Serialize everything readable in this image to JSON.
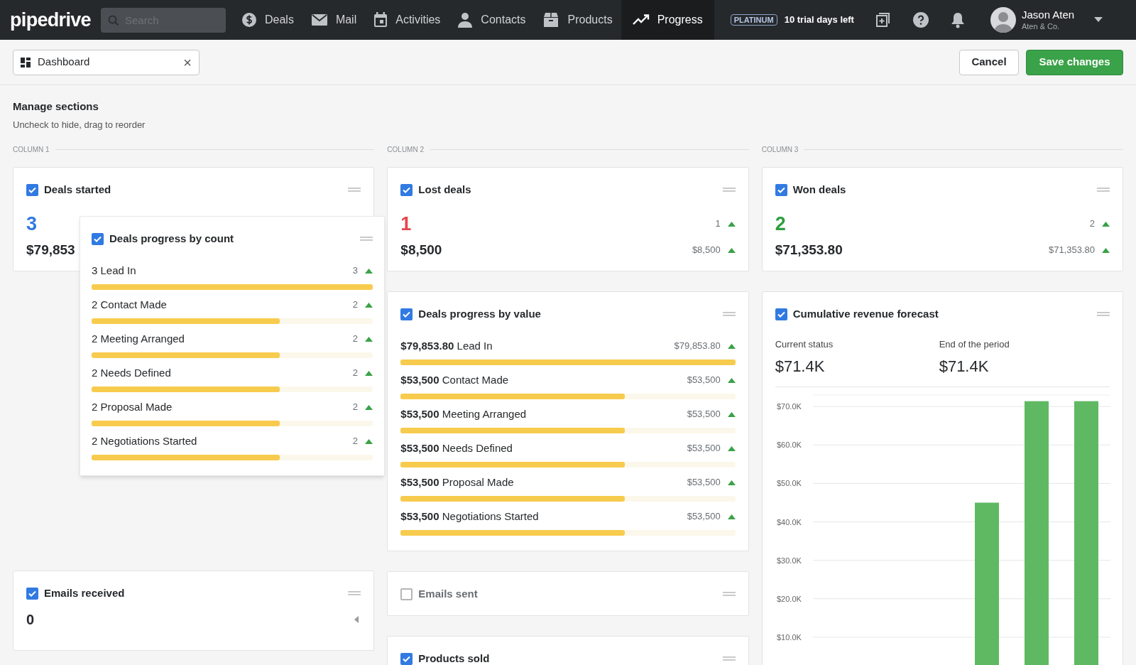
{
  "nav": {
    "logo": "pipedrive",
    "search": {
      "placeholder": "Search"
    },
    "items": [
      {
        "label": "Deals",
        "selected": false
      },
      {
        "label": "Mail",
        "selected": false
      },
      {
        "label": "Activities",
        "selected": false
      },
      {
        "label": "Contacts",
        "selected": false
      },
      {
        "label": "Products",
        "selected": false
      },
      {
        "label": "Progress",
        "selected": true
      }
    ],
    "plan_badge": "PLATINUM",
    "trial": "10 trial days left",
    "user": {
      "name": "Jason Aten",
      "company": "Aten & Co."
    }
  },
  "toolbar": {
    "dashboard_field": {
      "value": "Dashboard",
      "clear": "×"
    },
    "buttons": [
      {
        "label": "Cancel",
        "kind": "secondary"
      },
      {
        "label": "Save changes",
        "kind": "primary"
      }
    ]
  },
  "manage": {
    "title": "Manage sections",
    "subtitle": "Uncheck to hide, drag to reorder"
  },
  "columns": [
    {
      "label": "COLUMN 1",
      "cards": [
        {
          "kind": "stat",
          "title": "Deals started",
          "checked": true,
          "count": "3",
          "color": "#317ae2",
          "value": "$79,853"
        },
        {
          "kind": "placeholder"
        },
        {
          "kind": "count",
          "title": "Emails received",
          "checked": true,
          "value": "0"
        }
      ]
    },
    {
      "label": "COLUMN 2",
      "cards": [
        {
          "kind": "stat",
          "title": "Lost deals",
          "checked": true,
          "count": "1",
          "color": "#e5484d",
          "value": "$8,500",
          "count_change": "1",
          "value_change": "$8,500"
        },
        {
          "kind": "progress",
          "title": "Deals progress by value",
          "checked": true,
          "items": [
            {
              "label": "**$79,853.80** Lead In",
              "side": "$79,853.80",
              "level": 1
            },
            {
              "label": "**$53,500** Contact Made",
              "side": "$53,500",
              "level": 0.67
            },
            {
              "label": "**$53,500** Meeting Arranged",
              "side": "$53,500",
              "level": 0.67
            },
            {
              "label": "**$53,500** Needs Defined",
              "side": "$53,500",
              "level": 0.67
            },
            {
              "label": "**$53,500** Proposal Made",
              "side": "$53,500",
              "level": 0.67
            },
            {
              "label": "**$53,500** Negotiations Started",
              "side": "$53,500",
              "level": 0.67
            }
          ]
        },
        {
          "kind": "header",
          "title": "Emails sent",
          "checked": false
        },
        {
          "kind": "header",
          "title": "Products sold",
          "checked": true
        }
      ]
    },
    {
      "label": "COLUMN 3",
      "cards": [
        {
          "kind": "stat",
          "title": "Won deals",
          "checked": true,
          "count": "2",
          "color": "#2e9e3e",
          "value": "$71,353.80",
          "count_change": "2",
          "value_change": "$71,353.80"
        },
        {
          "kind": "forecast",
          "title": "Cumulative revenue forecast",
          "checked": true,
          "current_label": "Current status",
          "current": "$71.4K",
          "end_label": "End of the period",
          "end": "$71.4K",
          "chart_data": {
            "type": "bar",
            "values": [
              null,
              null,
              null,
              45000,
              71400,
              71400
            ],
            "ylim": [
              0,
              73000
            ],
            "grid": true,
            "yticks": [
              {
                "value": 10000,
                "label": "$10.0K"
              },
              {
                "value": 20000,
                "label": "$20.0K"
              },
              {
                "value": 30000,
                "label": "$30.0K"
              },
              {
                "value": 40000,
                "label": "$40.0K"
              },
              {
                "value": 50000,
                "label": "$50.0K"
              },
              {
                "value": 60000,
                "label": "$60.0K"
              },
              {
                "value": 70000,
                "label": "$70.0K"
              }
            ]
          }
        }
      ]
    }
  ],
  "dragged_card": {
    "kind": "progress",
    "title": "Deals progress by count",
    "checked": true,
    "items": [
      {
        "label": "3 Lead In",
        "side": "3",
        "level": 1
      },
      {
        "label": "2 Contact Made",
        "side": "2",
        "level": 0.67
      },
      {
        "label": "2 Meeting Arranged",
        "side": "2",
        "level": 0.67
      },
      {
        "label": "2 Needs Defined",
        "side": "2",
        "level": 0.67
      },
      {
        "label": "2 Proposal Made",
        "side": "2",
        "level": 0.67
      },
      {
        "label": "2 Negotiations Started",
        "side": "2",
        "level": 0.67
      }
    ]
  }
}
